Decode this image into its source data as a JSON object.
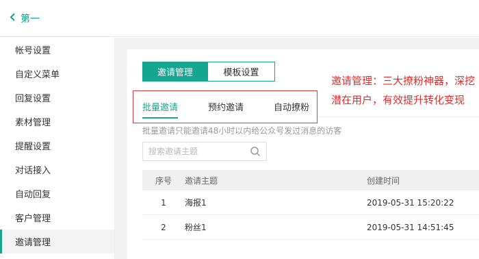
{
  "topbar": {
    "back_label": "第一"
  },
  "sidebar": {
    "items": [
      {
        "label": "帐号设置"
      },
      {
        "label": "自定义菜单"
      },
      {
        "label": "回复设置"
      },
      {
        "label": "素材管理"
      },
      {
        "label": "提醒设置"
      },
      {
        "label": "对话接入"
      },
      {
        "label": "自动回复"
      },
      {
        "label": "客户管理"
      },
      {
        "label": "邀请管理",
        "active": true
      }
    ]
  },
  "tabs": [
    {
      "label": "邀请管理",
      "active": true
    },
    {
      "label": "模板设置",
      "active": false
    }
  ],
  "subtabs": [
    {
      "label": "批量邀请",
      "active": true
    },
    {
      "label": "预约邀请",
      "active": false
    },
    {
      "label": "自动撩粉",
      "active": false
    }
  ],
  "hint": "批量邀请只能邀请48小时以内给公众号发过消息的访客",
  "search": {
    "placeholder": "搜索邀请主题"
  },
  "table": {
    "headers": [
      "序号",
      "邀请主题",
      "创建时间"
    ],
    "rows": [
      [
        "1",
        "海报1",
        "2019-05-31 15:20:22"
      ],
      [
        "2",
        "粉丝1",
        "2019-05-31 14:51:45"
      ]
    ]
  },
  "annotation": "邀请管理：三大撩粉神器，深挖潜在用户，有效提升转化变现",
  "colors": {
    "accent": "#16a58e",
    "annotation_red": "#e22d2d"
  }
}
